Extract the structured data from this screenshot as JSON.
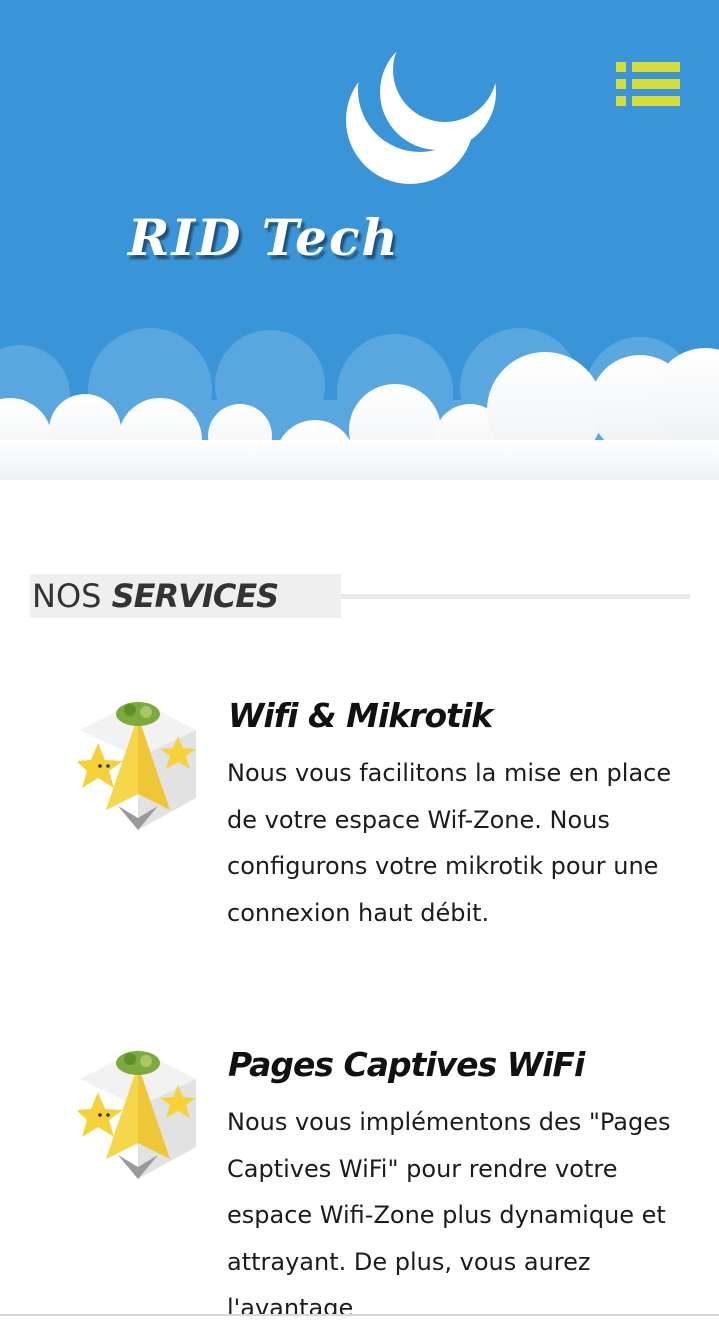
{
  "header": {
    "brand": "RID Tech",
    "logo_icon": "crescent-moon-icon",
    "menu_icon": "list-menu-icon",
    "colors": {
      "sky": "#3a95d8",
      "menu": "#d8dc3a",
      "cloud": "#ffffff"
    }
  },
  "services_section": {
    "title_light": "NOS ",
    "title_bold": "SERVICES",
    "items": [
      {
        "title": "Wifi & Mikrotik",
        "description": "Nous vous facilitons la mise en place de votre espace Wif-Zone. Nous configurons votre mikrotik pour une connexion haut débit.",
        "icon": "star-cube-icon"
      },
      {
        "title": "Pages Captives WiFi",
        "description": "Nous vous implémentons des \"Pages Captives WiFi\" pour rendre votre espace Wifi-Zone plus dynamique et attrayant. De plus, vous aurez l'avantage",
        "icon": "star-cube-icon"
      }
    ]
  }
}
